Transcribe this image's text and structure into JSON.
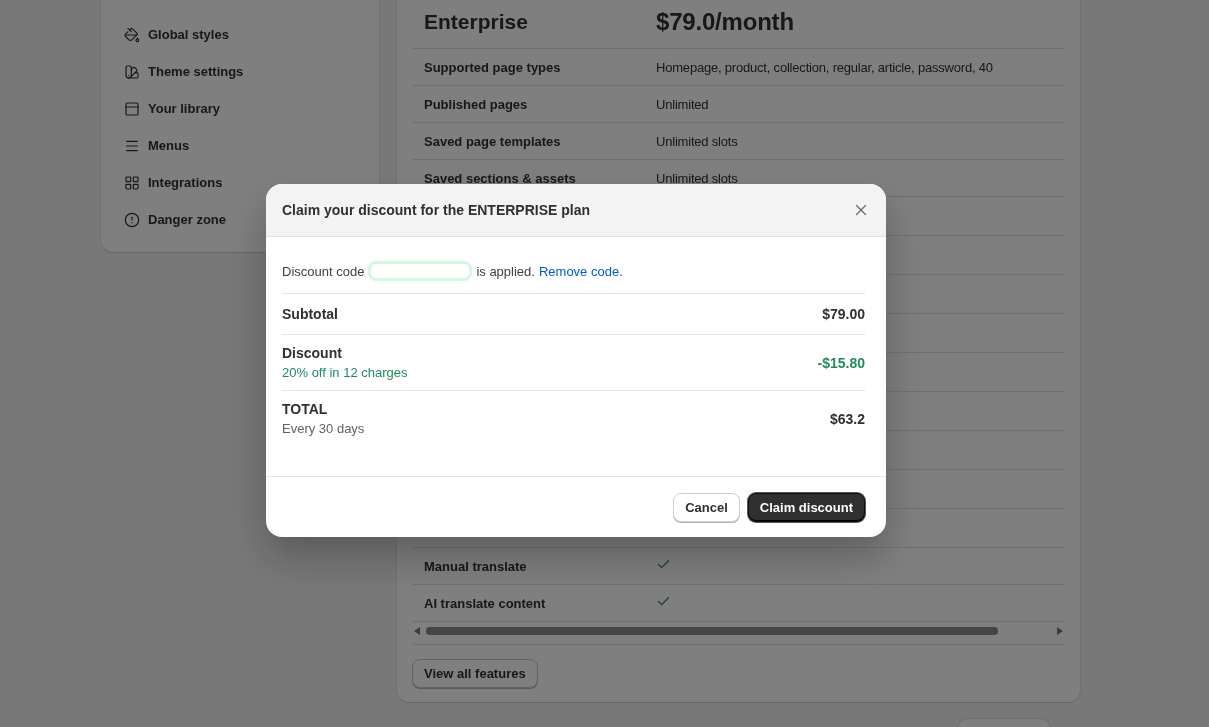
{
  "sidebar": {
    "items": [
      {
        "label": "Global styles"
      },
      {
        "label": "Theme settings"
      },
      {
        "label": "Your library"
      },
      {
        "label": "Menus"
      },
      {
        "label": "Integrations"
      },
      {
        "label": "Danger zone"
      }
    ]
  },
  "plan": {
    "name": "Enterprise",
    "price": "$79.0/month",
    "features": [
      {
        "kind": "text",
        "label": "Supported page types",
        "value": "Homepage, product, collection, regular, article, password, 40"
      },
      {
        "kind": "text",
        "label": "Published pages",
        "value": "Unlimited"
      },
      {
        "kind": "text",
        "label": "Saved page templates",
        "value": "Unlimited slots"
      },
      {
        "kind": "text",
        "label": "Saved sections & assets",
        "value": "Unlimited slots"
      },
      {
        "kind": "hidden"
      },
      {
        "kind": "check",
        "label": "Manual translate",
        "included": true
      },
      {
        "kind": "check",
        "label": "AI translate content",
        "included": true
      }
    ],
    "view_all_button": "View all features"
  },
  "dialog": {
    "title": "Claim your discount for the ENTERPRISE plan",
    "code_prefix": "Discount code",
    "code_suffix": "is applied.",
    "remove_link": "Remove code.",
    "lines": [
      {
        "kind": "plain",
        "label": "Subtotal",
        "amount": "$79.00"
      },
      {
        "kind": "discount",
        "label": "Discount",
        "note": "20% off in 12 charges",
        "amount": "-$15.80"
      },
      {
        "kind": "total",
        "label": "TOTAL",
        "note": "Every 30 days",
        "amount": "$63.2"
      }
    ],
    "buttons": [
      {
        "kind": "secondary",
        "label": "Cancel"
      },
      {
        "kind": "primary",
        "label": "Claim discount"
      }
    ]
  }
}
